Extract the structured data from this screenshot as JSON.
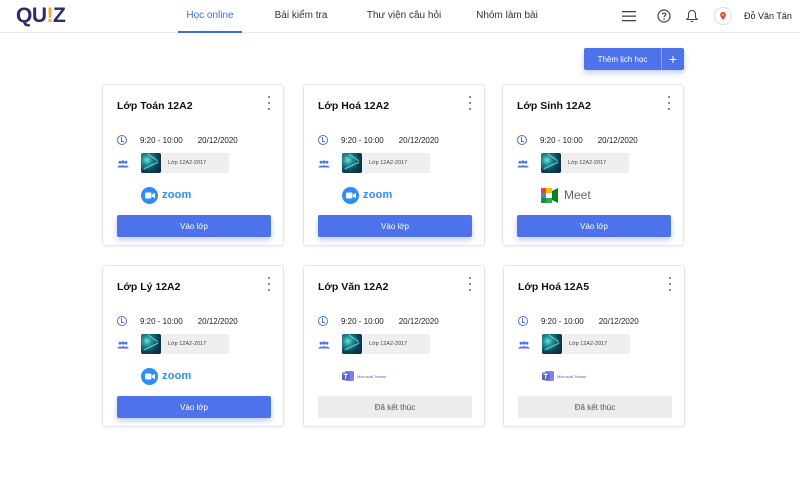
{
  "logo": {
    "q": "QU",
    "bang": "!",
    "z": "Z"
  },
  "nav": {
    "items": [
      {
        "label": "Học online",
        "active": true
      },
      {
        "label": "Bài kiểm tra",
        "active": false
      },
      {
        "label": "Thư viện câu hỏi",
        "active": false
      },
      {
        "label": "Nhóm làm  bài",
        "active": false
      }
    ]
  },
  "header": {
    "icons": [
      "menu-icon",
      "help-icon",
      "bell-icon"
    ],
    "user_name": "Đỗ Văn Tân"
  },
  "toolbar": {
    "add_schedule_label": "Thêm lịch học"
  },
  "cards": [
    {
      "title": "Lớp Toán 12A2",
      "time": "9:20 - 10:00",
      "date": "20/12/2020",
      "class_label": "Lớp  12A2-2017",
      "platform": "zoom",
      "platform_label": "zoom",
      "button_label": "Vào lớp",
      "button_state": "join"
    },
    {
      "title": "Lớp Hoá 12A2",
      "time": "9:20 - 10:00",
      "date": "20/12/2020",
      "class_label": "Lớp  12A2-2017",
      "platform": "zoom",
      "platform_label": "zoom",
      "button_label": "Vào lớp",
      "button_state": "join"
    },
    {
      "title": "Lớp Sinh 12A2",
      "time": "9:20 - 10:00",
      "date": "20/12/2020",
      "class_label": "Lớp  12A2-2017",
      "platform": "meet",
      "platform_label": "Meet",
      "button_label": "Vào lớp",
      "button_state": "join"
    },
    {
      "title": "Lớp Lý 12A2",
      "time": "9:20 - 10:00",
      "date": "20/12/2020",
      "class_label": "Lớp  12A2-2017",
      "platform": "zoom",
      "platform_label": "zoom",
      "button_label": "Vào lớp",
      "button_state": "join"
    },
    {
      "title": "Lớp Văn 12A2",
      "time": "9:20 - 10:00",
      "date": "20/12/2020",
      "class_label": "Lớp  12A2-2017",
      "platform": "teams",
      "platform_label": "Microsoft Teams",
      "button_label": "Đã kết thúc",
      "button_state": "ended"
    },
    {
      "title": "Lớp Hoá 12A5",
      "time": "9:20 - 10:00",
      "date": "20/12/2020",
      "class_label": "Lớp  12A2-2017",
      "platform": "teams",
      "platform_label": "Microsoft Teams",
      "button_label": "Đã kết thúc",
      "button_state": "ended"
    }
  ],
  "colors": {
    "accent": "#4d72ea",
    "zoom": "#2d8cff",
    "ended": "#ececec"
  }
}
